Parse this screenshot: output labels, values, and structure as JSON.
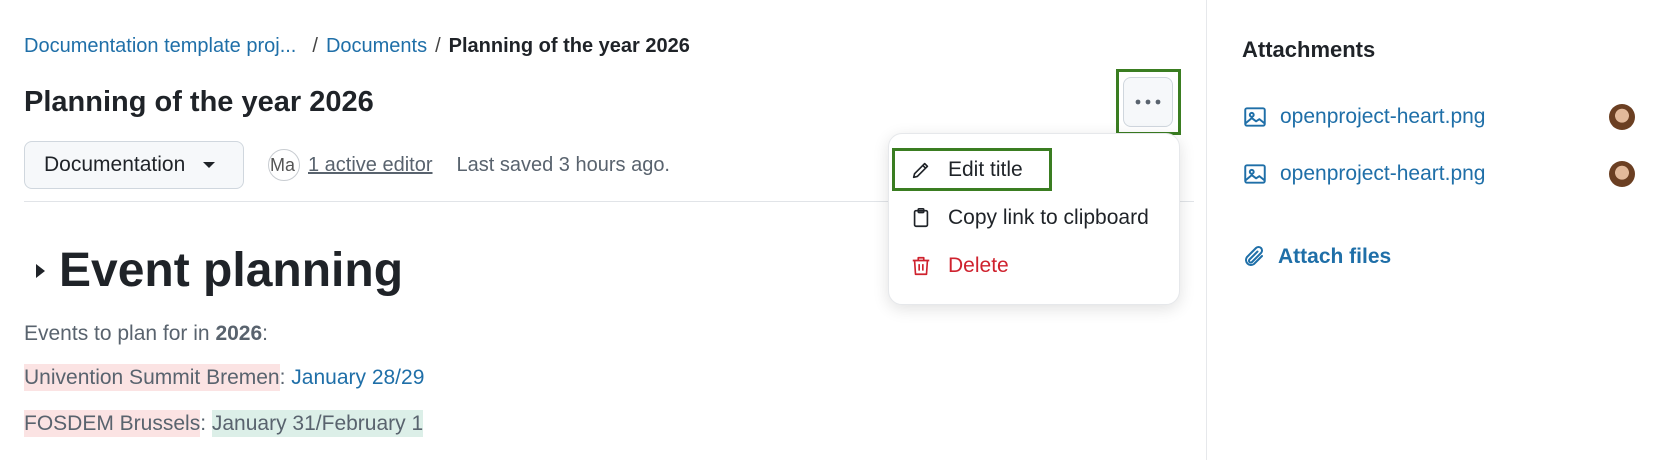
{
  "breadcrumb": {
    "project": "Documentation template proj...",
    "separator": "/",
    "documents": "Documents",
    "current": "Planning of the year 2026"
  },
  "page": {
    "title": "Planning of the year 2026"
  },
  "meta": {
    "type_select": "Documentation",
    "avatar_initials": "Ma",
    "active_editors": "1 active editor",
    "last_saved": "Last saved 3 hours ago."
  },
  "menu": {
    "edit_title": "Edit title",
    "copy_link": "Copy link to clipboard",
    "delete": "Delete"
  },
  "content": {
    "heading": "Event planning",
    "intro_prefix": "Events to plan for in ",
    "intro_year": "2026",
    "intro_suffix": ":",
    "event1_name": "Univention Summit Bremen",
    "event1_sep": ": ",
    "event1_date": "January 28/29",
    "event2_name": "FOSDEM Brussels",
    "event2_sep": ": ",
    "event2_date": "January 31/February 1"
  },
  "sidebar": {
    "title": "Attachments",
    "attachments": [
      {
        "name": "openproject-heart.png"
      },
      {
        "name": "openproject-heart.png"
      }
    ],
    "attach_files": "Attach files"
  },
  "colors": {
    "link": "#1f6fa8",
    "danger": "#cf222e",
    "highlight_outline": "#3a7d21",
    "highlight_red": "#fbe3e3",
    "highlight_green": "#dcefe8"
  },
  "icons": {
    "more": "kebab-horizontal-icon",
    "type_select": "triangle-down-icon",
    "edit": "pencil-icon",
    "copy": "clipboard-icon",
    "delete": "trash-icon",
    "attachment": "image-icon",
    "attach_files": "paperclip-icon"
  }
}
